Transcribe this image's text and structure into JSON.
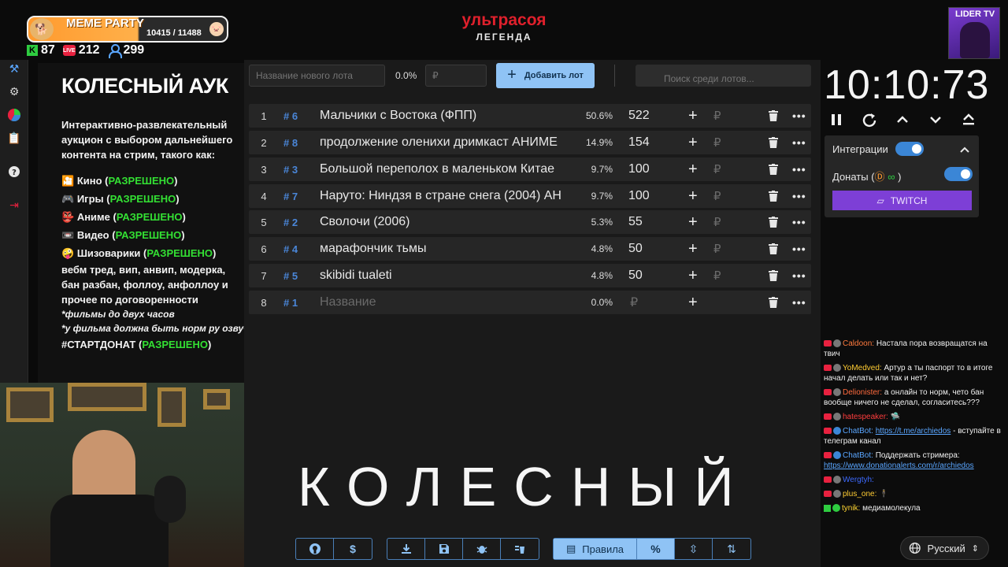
{
  "overlay": {
    "meme_title": "MEME PARTY",
    "meme_progress": "10415 / 11488",
    "kick_count": "87",
    "live_label": "LIVE",
    "live_count": "212",
    "viewers": "299",
    "brand_title": "ультрасоя",
    "brand_sub": "ЛЕГЕНДА",
    "channel_label": "LIDER TV"
  },
  "info": {
    "title": "КОЛЕСНЫЙ АУК",
    "description": "Интерактивно-развлекательный аукцион с выбором дальнейшего контента на стрим, такого как:",
    "allowed": "РАЗРЕШЕНО",
    "categories": [
      {
        "emoji": "🎦",
        "label": "Кино"
      },
      {
        "emoji": "🎮",
        "label": "Игры"
      },
      {
        "emoji": "👺",
        "label": "Аниме"
      },
      {
        "emoji": "📼",
        "label": "Видео"
      },
      {
        "emoji": "🤪",
        "label": "Шизоварики"
      }
    ],
    "extra": "вебм тред, вип, анвип, модерка, бан разбан, фоллоу, анфоллоу и прочее по договоренности",
    "note1": "*фильмы до двух часов",
    "note2": "*у фильма должна быть норм ру озвуч",
    "startdonat": "#СТАРТДОНАТ"
  },
  "toolbar": {
    "new_lot_placeholder": "Название нового лота",
    "percent": "0.0%",
    "amount_placeholder": "₽",
    "add_label": "Добавить лот",
    "search_placeholder": "Поиск среди лотов..."
  },
  "lots": [
    {
      "num": "1",
      "id": "# 6",
      "name": "Мальчики с Востока (ФПП)",
      "pct": "50.6%",
      "amount": "522"
    },
    {
      "num": "2",
      "id": "# 8",
      "name": "продолжение оленихи дримкаст АНИМЕ",
      "pct": "14.9%",
      "amount": "154"
    },
    {
      "num": "3",
      "id": "# 3",
      "name": "Большой переполох в маленьком Китае",
      "pct": "9.7%",
      "amount": "100"
    },
    {
      "num": "4",
      "id": "# 7",
      "name": "Наруто: Ниндзя в стране снега (2004) АН",
      "pct": "9.7%",
      "amount": "100"
    },
    {
      "num": "5",
      "id": "# 2",
      "name": "Сволочи (2006)",
      "pct": "5.3%",
      "amount": "55"
    },
    {
      "num": "6",
      "id": "# 4",
      "name": "марафончик тьмы",
      "pct": "4.8%",
      "amount": "50"
    },
    {
      "num": "7",
      "id": "# 5",
      "name": "skibidi tualeti",
      "pct": "4.8%",
      "amount": "50"
    },
    {
      "num": "8",
      "id": "# 1",
      "name": "Название",
      "pct": "0.0%",
      "amount": "₽"
    }
  ],
  "row_labels": {
    "plus": "+",
    "currency": "₽",
    "more": "•••"
  },
  "big_word": "КОЛЕСНЫЙ",
  "bottom": {
    "rules_label": "Правила",
    "percent_label": "%"
  },
  "timer": "10:10:73",
  "integrations": {
    "label": "Интеграции",
    "donations": "Донаты (",
    "donations_end": ")",
    "twitch": "TWITCH"
  },
  "chat": [
    {
      "user": "Caldoon:",
      "color": "#ff7a3d",
      "text": "Настала пора возвращатся на твич"
    },
    {
      "user": "YoMedved:",
      "color": "#ffcc33",
      "text": "Артур а ты паспорт то в итоге начал делать или так и нет?"
    },
    {
      "user": "Delionister:",
      "color": "#ff6a3d",
      "text": "а онлайн то норм, чето бан вообще ничего не сделал, согласитесь???"
    },
    {
      "user": "hatespeaker:",
      "color": "#ff3d3d",
      "text": "🛸"
    },
    {
      "user": "ChatBot:",
      "color": "#5aa6ff",
      "link": "https://t.me/archiedos",
      "text": "- вступайте в телеграм канал"
    },
    {
      "user": "ChatBot:",
      "color": "#5aa6ff",
      "text": "Поддержать стримера:",
      "link": "https://www.donationalerts.com/r/archiedos"
    },
    {
      "user": "Wergtyh:",
      "color": "#3d6aff",
      "text": ""
    },
    {
      "user": "plus_one:",
      "color": "#ffcc33",
      "text": "🕴"
    },
    {
      "user": "tynik:",
      "color": "#ffd633",
      "text": "медиамолекула"
    }
  ],
  "language": "Русский"
}
